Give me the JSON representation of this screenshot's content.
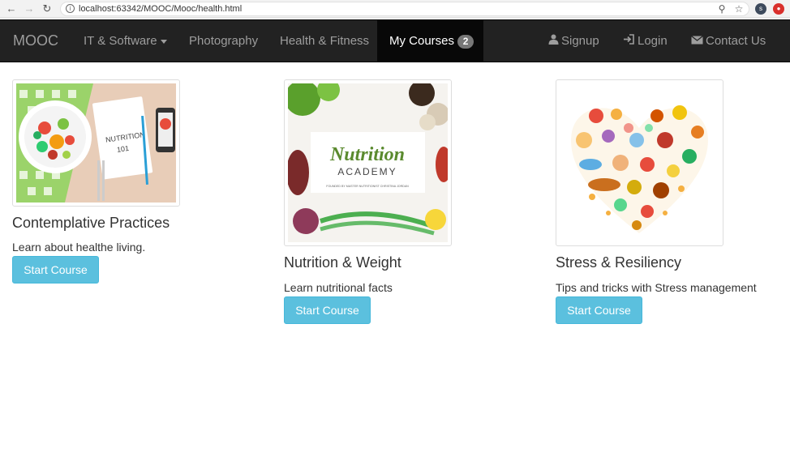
{
  "browser": {
    "url": "localhost:63342/MOOC/Mooc/health.html",
    "ext_label": "s"
  },
  "navbar": {
    "brand": "MOOC",
    "items": [
      {
        "label": "IT & Software",
        "dropdown": true
      },
      {
        "label": "Photography"
      },
      {
        "label": "Health & Fitness"
      },
      {
        "label": "My Courses",
        "badge": "2",
        "active": true
      }
    ],
    "right": [
      {
        "label": "Signup",
        "icon": "user-icon"
      },
      {
        "label": "Login",
        "icon": "login-icon"
      },
      {
        "label": "Contact Us",
        "icon": "envelope-icon"
      }
    ]
  },
  "courses": [
    {
      "title": "Contemplative Practices",
      "description": "Learn about healthe living.",
      "button": "Start Course",
      "image": "nutrition-101-salad-plate",
      "image_text": "NUTRITION 101"
    },
    {
      "title": "Nutrition & Weight",
      "description": "Learn nutritional facts",
      "button": "Start Course",
      "image": "nutrition-academy-vegetables",
      "image_text": {
        "title": "Nutrition",
        "subtitle": "ACADEMY",
        "tagline": "FOUNDED BY MASTER NUTRITIONIST CHRISTINA JORDAN"
      }
    },
    {
      "title": "Stress & Resiliency",
      "description": "Tips and tricks with Stress management",
      "button": "Start Course",
      "image": "food-heart-illustration"
    }
  ],
  "colors": {
    "navbar_bg": "#222222",
    "navbar_active_bg": "#080808",
    "navbar_text": "#9d9d9d",
    "button_bg": "#5bc0de",
    "badge_bg": "#777777"
  }
}
